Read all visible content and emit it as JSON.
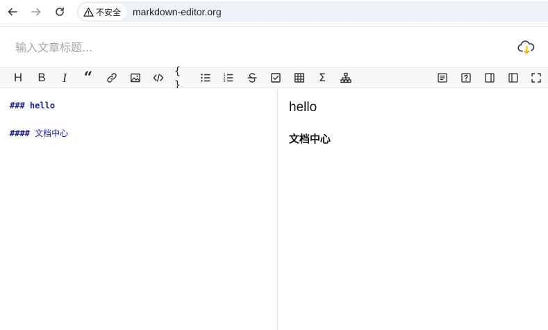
{
  "browser": {
    "security_label": "不安全",
    "url": "markdown-editor.org",
    "back_icon": "arrow-left-icon",
    "forward_icon": "arrow-right-icon",
    "reload_icon": "reload-icon",
    "warning_icon": "warning-triangle-icon"
  },
  "title_bar": {
    "placeholder": "输入文章标题...",
    "value": "",
    "save_icon": "cloud-upload-icon"
  },
  "toolbar": {
    "left_tools": [
      {
        "name": "heading",
        "label": "H"
      },
      {
        "name": "bold",
        "label": "B"
      },
      {
        "name": "italic",
        "label": "I"
      },
      {
        "name": "quote",
        "label": "“"
      },
      {
        "name": "link",
        "label": ""
      },
      {
        "name": "image",
        "label": ""
      },
      {
        "name": "inline-code",
        "label": ""
      },
      {
        "name": "code-block",
        "label": "{ }"
      },
      {
        "name": "unordered-list",
        "label": ""
      },
      {
        "name": "ordered-list",
        "label": ""
      },
      {
        "name": "strikethrough",
        "label": ""
      },
      {
        "name": "task-list",
        "label": ""
      },
      {
        "name": "table",
        "label": ""
      },
      {
        "name": "formula",
        "label": "Σ"
      },
      {
        "name": "mermaid",
        "label": ""
      }
    ],
    "right_tools": [
      {
        "name": "toc"
      },
      {
        "name": "help"
      },
      {
        "name": "preview-only"
      },
      {
        "name": "editor-only"
      },
      {
        "name": "fullscreen"
      }
    ]
  },
  "editor": {
    "lines": [
      {
        "prefix": "###",
        "text": "hello"
      },
      {
        "prefix": "####",
        "text": "文档中心"
      }
    ]
  },
  "preview": {
    "h3": "hello",
    "h4": "文档中心"
  },
  "colors": {
    "markdown_text": "#1a1aa6",
    "toolbar_bg": "#f6f7f9",
    "omnibox_bg": "#eef1f8",
    "cloud_accent": "#f5b400"
  }
}
